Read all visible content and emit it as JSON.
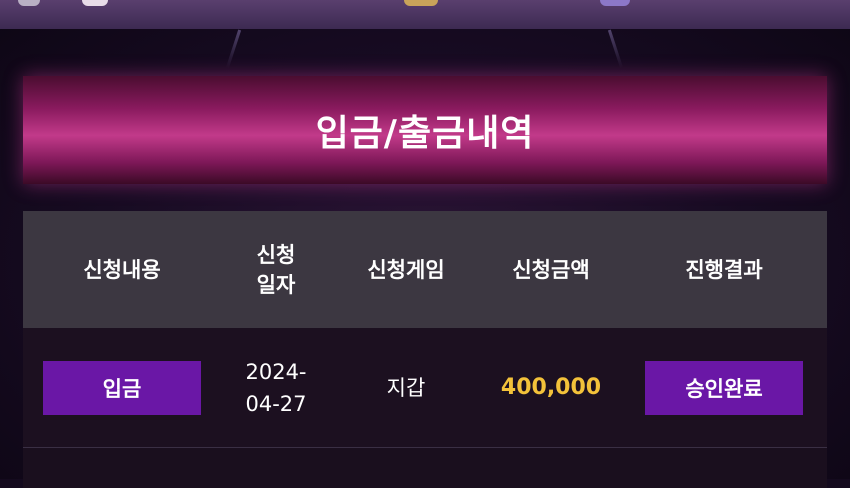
{
  "page": {
    "title": "입금/출금내역"
  },
  "table": {
    "headers": {
      "type": "신청내용",
      "date_line1": "신청",
      "date_line2": "일자",
      "game": "신청게임",
      "amount": "신청금액",
      "result": "진행결과"
    },
    "rows": [
      {
        "type": "입금",
        "date_line1": "2024-",
        "date_line2": "04-27",
        "game": "지갑",
        "amount": "400,000",
        "result": "승인완료"
      }
    ]
  },
  "colors": {
    "accent_purple": "#6a17a6",
    "amount_gold": "#f3c23a",
    "banner_pink": "#c23a8a"
  }
}
